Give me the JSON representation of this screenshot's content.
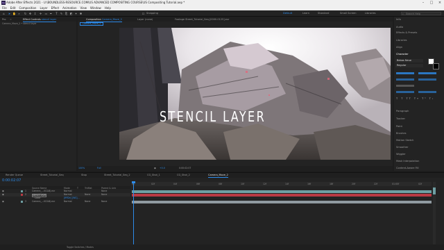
{
  "window": {
    "title": "Adobe After Effects 2021 - U:\\BOUNDLESS-RESOURCE.COM\\US ADVANCED COMPOSITING COURSE\\US Compositing Tutorial.aep *",
    "app_badge": "Ae"
  },
  "menu": [
    "File",
    "Edit",
    "Composition",
    "Layer",
    "Effect",
    "Animation",
    "View",
    "Window",
    "Help"
  ],
  "toolbar": {
    "snapping_label": "Snapping",
    "workspaces": [
      "Default",
      "Learn",
      "Standard",
      "Small Screen",
      "Libraries"
    ],
    "search_placeholder": "Search Help"
  },
  "left_panel": {
    "tab_project": "Pro",
    "tab_effect_controls": "Effect Controls",
    "effect_layer_name": "stencil layer",
    "header": "Camera_Move_2 • stencil layer"
  },
  "viewer": {
    "tab_composition": "Composition",
    "comp_name": "Camera_Move_2",
    "tab_layer": "Layer (none)",
    "tab_footage": "Footage  Street_Tutorial_Seq.[0000-0125].exr",
    "breadcrumb": "Camera_Move_2",
    "overlay_text": "STENCIL LAYER",
    "zoom": "100%",
    "resolution": "Full",
    "exposure": "+0.0",
    "timecode": "0:00:02:07"
  },
  "right_panel": {
    "items": [
      "Info",
      "Audio",
      "Effects & Presets",
      "Libraries",
      "Align",
      "Character"
    ],
    "font_name": "Bebas Neue",
    "font_style": "Regular",
    "lower_items": [
      "Paragraph",
      "Tracker",
      "Paint",
      "Brushes",
      "Motion Sketch",
      "Smoother",
      "Wiggler",
      "Mask Interpolation",
      "Content-Aware Fill"
    ]
  },
  "timeline": {
    "tabs": [
      "Render Queue",
      "Street_Tutorial_Seq",
      "Stop",
      "Street_Tutorial_Seq_2",
      "CG_Shot_1",
      "CG_Shot_2",
      "Camera_Move_2"
    ],
    "current_time": "0:00:02:07",
    "column_headers": [
      "Source Name",
      "Mode",
      "T",
      "TrkMat",
      "Parent & Link"
    ],
    "ruler": [
      "0s",
      "02f",
      "04f",
      "06f",
      "08f",
      "10f",
      "12f",
      "14f",
      "16f",
      "18f",
      "20f",
      "22f",
      "01:00f",
      "02f"
    ],
    "layers": [
      {
        "num": "1",
        "name": "Camera_...IIC&B).exr",
        "mode": "Normal",
        "trk": "",
        "parent": "None"
      },
      {
        "num": "2",
        "name": "stencil layer",
        "mode": "Normal",
        "trk": "None",
        "parent": "None"
      },
      {
        "num": "",
        "name": "Color",
        "mode": "",
        "trk": "",
        "parent": "",
        "value": "[ffff2e] [WS]..."
      },
      {
        "num": "3",
        "name": "Camera_...IIC&B).exr",
        "mode": "Normal",
        "trk": "None",
        "parent": "None"
      }
    ],
    "footer": "Toggle Switches / Modes"
  },
  "colors": {
    "accent": "#2d8ceb",
    "layer_red": "#b83a43",
    "layer_gray": "#8f9aa0",
    "layer_teal": "#6f9fa3"
  }
}
